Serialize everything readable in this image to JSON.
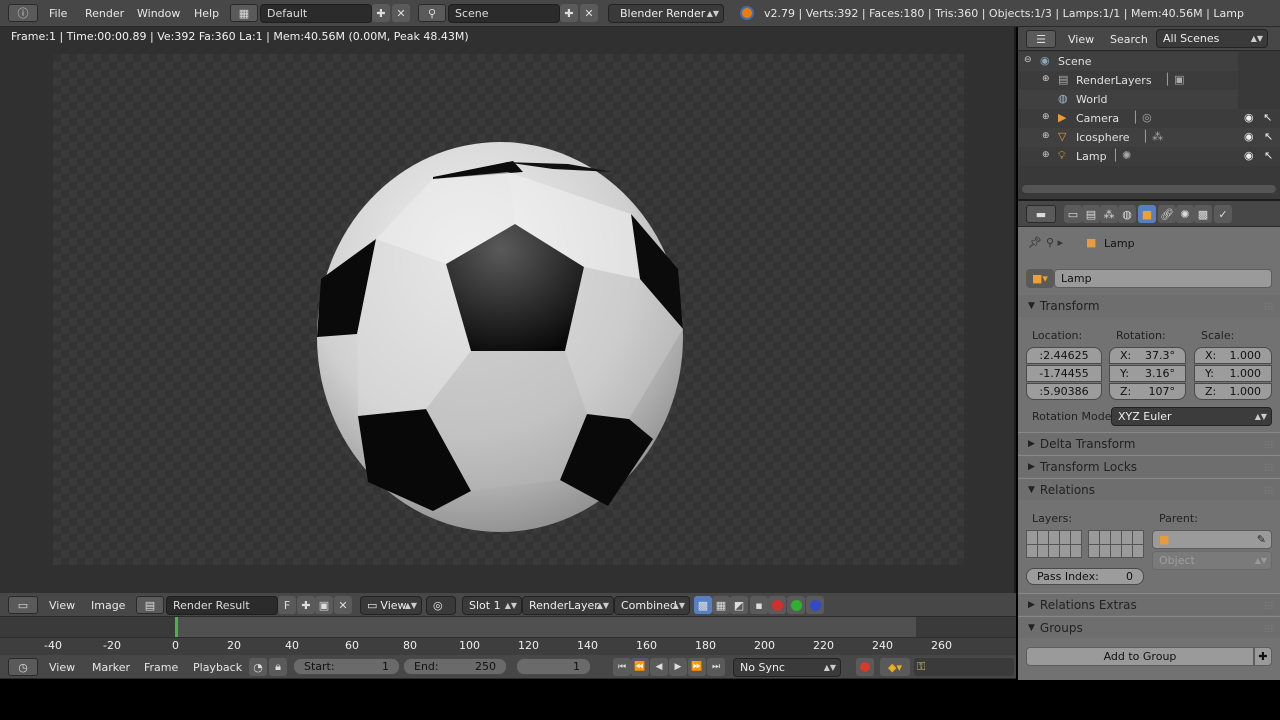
{
  "top": {
    "menus": [
      "File",
      "Render",
      "Window",
      "Help"
    ],
    "layout": "Default",
    "scene": "Scene",
    "engine": "Blender Render",
    "stats": "v2.79 | Verts:392 | Faces:180 | Tris:360 | Objects:1/3 | Lamps:1/1 | Mem:40.56M | Lamp"
  },
  "viewer": {
    "info": "Frame:1 | Time:00:00.89 | Ve:392 Fa:360 La:1 | Mem:40.56M (0.00M, Peak 48.43M)"
  },
  "image_header": {
    "view": "View",
    "image": "Image",
    "image_name": "Render Result",
    "fake_user": "F",
    "view_dropdown": "View",
    "slot": "Slot 1",
    "render_layer": "RenderLayer",
    "pass": "Combined"
  },
  "timeline": {
    "ticks": [
      "-40",
      "-20",
      "0",
      "20",
      "40",
      "60",
      "80",
      "100",
      "120",
      "140",
      "160",
      "180",
      "200",
      "220",
      "240",
      "260"
    ],
    "menus": [
      "View",
      "Marker",
      "Frame",
      "Playback"
    ],
    "start_label": "Start:",
    "start": "1",
    "end_label": "End:",
    "end": "250",
    "current": "1",
    "sync": "No Sync"
  },
  "outliner": {
    "view": "View",
    "search": "Search",
    "filter": "All Scenes",
    "items": [
      {
        "label": "Scene"
      },
      {
        "label": "RenderLayers"
      },
      {
        "label": "World"
      },
      {
        "label": "Camera"
      },
      {
        "label": "Icosphere"
      },
      {
        "label": "Lamp"
      }
    ]
  },
  "properties": {
    "breadcrumb": "Lamp",
    "object_name": "Lamp",
    "transform": {
      "title": "Transform",
      "location_label": "Location:",
      "rotation_label": "Rotation:",
      "scale_label": "Scale:",
      "location": [
        ":2.44625",
        "-1.74455",
        ":5.90386"
      ],
      "rotation": [
        {
          "axis": "X:",
          "value": "37.3°"
        },
        {
          "axis": "Y:",
          "value": "3.16°"
        },
        {
          "axis": "Z:",
          "value": "107°"
        }
      ],
      "scale": [
        {
          "axis": "X:",
          "value": "1.000"
        },
        {
          "axis": "Y:",
          "value": "1.000"
        },
        {
          "axis": "Z:",
          "value": "1.000"
        }
      ],
      "rotation_mode_label": "Rotation Mode:",
      "rotation_mode": "XYZ Euler"
    },
    "delta_transform": "Delta Transform",
    "transform_locks": "Transform Locks",
    "relations": {
      "title": "Relations",
      "layers_label": "Layers:",
      "parent_label": "Parent:",
      "parent_type": "Object",
      "pass_index_label": "Pass Index:",
      "pass_index": "0"
    },
    "relations_extras": "Relations Extras",
    "groups": {
      "title": "Groups",
      "add_button": "Add to Group"
    }
  },
  "colors": {
    "accent": "#5680c2",
    "bg_dark": "#303030",
    "panel": "#727272",
    "frame_marker": "#42b842"
  }
}
